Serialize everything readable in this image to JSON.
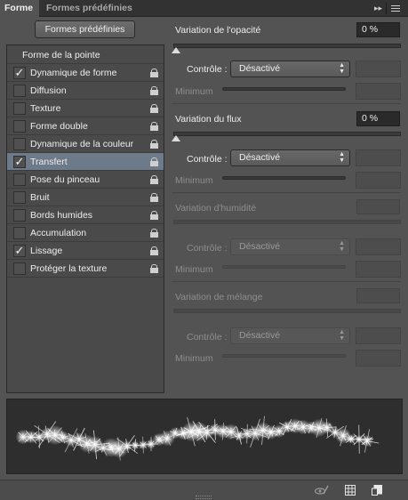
{
  "tabs": [
    {
      "label": "Forme",
      "active": true
    },
    {
      "label": "Formes prédéfinies",
      "active": false
    }
  ],
  "presets_button": "Formes prédéfinies",
  "list": {
    "header": "Forme de la pointe",
    "items": [
      {
        "label": "Dynamique de forme",
        "checked": true,
        "selected": false
      },
      {
        "label": "Diffusion",
        "checked": false,
        "selected": false
      },
      {
        "label": "Texture",
        "checked": false,
        "selected": false
      },
      {
        "label": "Forme double",
        "checked": false,
        "selected": false
      },
      {
        "label": "Dynamique de la couleur",
        "checked": false,
        "selected": false
      },
      {
        "label": "Transfert",
        "checked": true,
        "selected": true
      },
      {
        "label": "Pose du pinceau",
        "checked": false,
        "selected": false
      },
      {
        "label": "Bruit",
        "checked": false,
        "selected": false
      },
      {
        "label": "Bords humides",
        "checked": false,
        "selected": false
      },
      {
        "label": "Accumulation",
        "checked": false,
        "selected": false
      },
      {
        "label": "Lissage",
        "checked": true,
        "selected": false
      },
      {
        "label": "Protéger la texture",
        "checked": false,
        "selected": false
      }
    ]
  },
  "opacity": {
    "label": "Variation de l'opacité",
    "value": "0 %",
    "slider_fraction": 0,
    "control_label": "Contrôle :",
    "control_value": "Désactivé",
    "minimum_label": "Minimum"
  },
  "flow": {
    "label": "Variation du flux",
    "value": "0 %",
    "slider_fraction": 0,
    "control_label": "Contrôle :",
    "control_value": "Désactivé",
    "minimum_label": "Minimum"
  },
  "wetness": {
    "label": "Variation d'humidité",
    "control_label": "Contrôle :",
    "control_value": "Désactivé",
    "minimum_label": "Minimum"
  },
  "mix": {
    "label": "Variation de mélange",
    "control_label": "Contrôle :",
    "control_value": "Désactivé",
    "minimum_label": "Minimum"
  },
  "icons": {
    "checkmark": "✓",
    "panel_arrows": "▸▸",
    "select_arrows": "▲▼",
    "lock": "lock-icon",
    "bottom": [
      "brush-eye-icon",
      "grid-icon",
      "new-preset-icon"
    ]
  },
  "colors": {
    "panel_bg": "#535353",
    "selected_row": "#6d7a8a",
    "preview_bg": "#2e2e2e"
  }
}
